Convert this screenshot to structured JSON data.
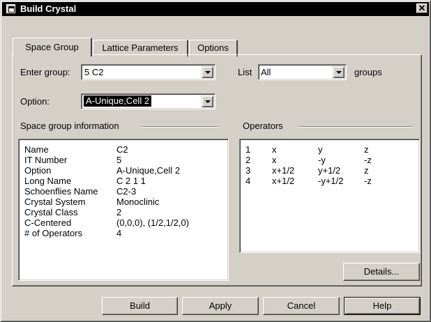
{
  "window": {
    "title": "Build Crystal",
    "close_glyph": "✕"
  },
  "tabs": [
    {
      "label": "Space Group"
    },
    {
      "label": "Lattice Parameters"
    },
    {
      "label": "Options"
    }
  ],
  "form": {
    "enter_group_label": "Enter group:",
    "enter_group_value": "5  C2",
    "option_label": "Option:",
    "option_value": "A-Unique,Cell 2",
    "list_label": "List",
    "list_value": "All",
    "groups_label": "groups"
  },
  "info_section": {
    "title": "Space group information",
    "rows": [
      {
        "key": "Name",
        "value": "C2"
      },
      {
        "key": "IT Number",
        "value": "5"
      },
      {
        "key": "Option",
        "value": "A-Unique,Cell 2"
      },
      {
        "key": "Long Name",
        "value": "C 2 1 1"
      },
      {
        "key": "Schoenflies Name",
        "value": "C2-3"
      },
      {
        "key": "Crystal System",
        "value": "Monoclinic"
      },
      {
        "key": "Crystal Class",
        "value": "2"
      },
      {
        "key": "C-Centered",
        "value": "(0,0,0), (1/2,1/2,0)"
      },
      {
        "key": "# of Operators",
        "value": "4"
      }
    ]
  },
  "operators_section": {
    "title": "Operators",
    "rows": [
      {
        "n": "1",
        "x": "x",
        "y": "y",
        "z": "z"
      },
      {
        "n": "2",
        "x": "x",
        "y": "-y",
        "z": "-z"
      },
      {
        "n": "3",
        "x": "x+1/2",
        "y": "y+1/2",
        "z": "z"
      },
      {
        "n": "4",
        "x": "x+1/2",
        "y": "-y+1/2",
        "z": "-z"
      }
    ],
    "details_label": "Details..."
  },
  "buttons": {
    "build": "Build",
    "apply": "Apply",
    "cancel": "Cancel",
    "help": "Help"
  }
}
